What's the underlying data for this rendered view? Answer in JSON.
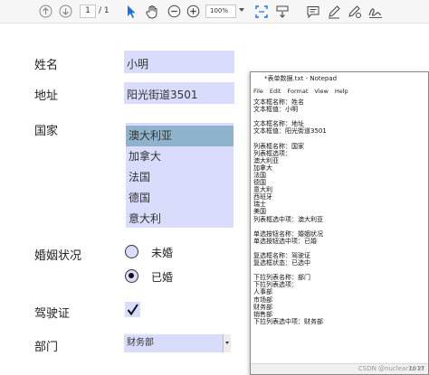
{
  "toolbar": {
    "page_current": "1",
    "page_total": "/ 1",
    "zoom": "100%",
    "icons": [
      "upload-icon",
      "download-icon",
      "select-cursor-icon",
      "hand-icon",
      "zoom-out-icon",
      "zoom-in-icon",
      "fit-page-icon",
      "scroll-mode-icon",
      "comment-icon",
      "highlight-pen-icon",
      "erase-pen-icon",
      "sign-icon"
    ]
  },
  "form": {
    "name_label": "姓名",
    "name_value": "小明",
    "address_label": "地址",
    "address_value": "阳光街道3501",
    "country_label": "国家",
    "countries": [
      "澳大利亚",
      "加拿大",
      "法国",
      "德国",
      "意大利"
    ],
    "selected_country_index": 0,
    "marital_label": "婚姻状况",
    "marital_options": [
      "未婚",
      "已婚"
    ],
    "marital_selected_index": 1,
    "license_label": "驾驶证",
    "license_checked": "✓",
    "dept_label": "部门",
    "dept_value": "财务部"
  },
  "notepad": {
    "title": "*表单数据.txt - Notepad",
    "menu": [
      "File",
      "Edit",
      "Format",
      "View",
      "Help"
    ],
    "content": "文本框名称：姓名\n文本框值：小明\n\n文本框名称：地址\n文本框值：阳光街道3501\n\n列表框名称：国家\n列表框选项：\n澳大利亚\n加拿大\n法国\n德国\n意大利\n西班牙\n瑞士\n美国\n列表框选中项：澳大利亚\n\n单选按钮名称：婚姻状况\n单选按钮选中项：已婚\n\n复选框名称：驾驶证\n复选框状态：已选中\n\n下拉列表名称：部门\n下拉列表选项：\n人事部\n市场部\n财务部\n销售部\n下拉列表选中项：财务部",
    "status": "Ln 27",
    "watermark": "CSDN @nuclear2011"
  },
  "colors": {
    "field_bg": "#d9dcfb",
    "selected_option_bg": "#8fb3cc",
    "toolbar_blue": "#1473e6"
  }
}
